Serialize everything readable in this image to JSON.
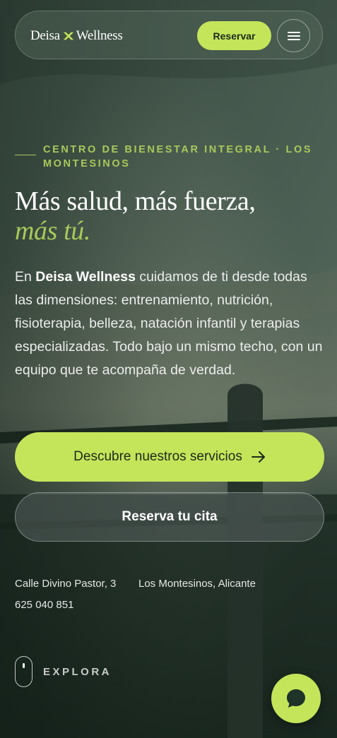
{
  "header": {
    "brand_left": "Deisa",
    "brand_right": "Wellness",
    "reserve_label": "Reservar",
    "menu_icon": "hamburger-menu-icon"
  },
  "hero": {
    "eyebrow": "Centro de bienestar integral · Los Montesinos",
    "title_line1": "Más salud, más fuerza,",
    "title_line2": "más tú.",
    "intro_prefix": "En ",
    "intro_brand": "Deisa Wellness",
    "intro_rest": " cuidamos de ti desde todas las dimensiones: entrenamiento, nutrición, fisioterapia, belleza, natación infantil y terapias especializadas. Todo bajo un mismo techo, con un equipo que te acompaña de verdad.",
    "primary_cta": "Descubre nuestros servicios",
    "secondary_cta": "Reserva tu cita"
  },
  "contact": {
    "street": "Calle Divino Pastor, 3",
    "city": "Los Montesinos, Alicante",
    "phone": "625 040 851"
  },
  "scroll": {
    "label": "EXPLORA"
  },
  "colors": {
    "accent": "#c4e55a",
    "accent_text": "#a8c95a",
    "background": "#1e2e24"
  }
}
